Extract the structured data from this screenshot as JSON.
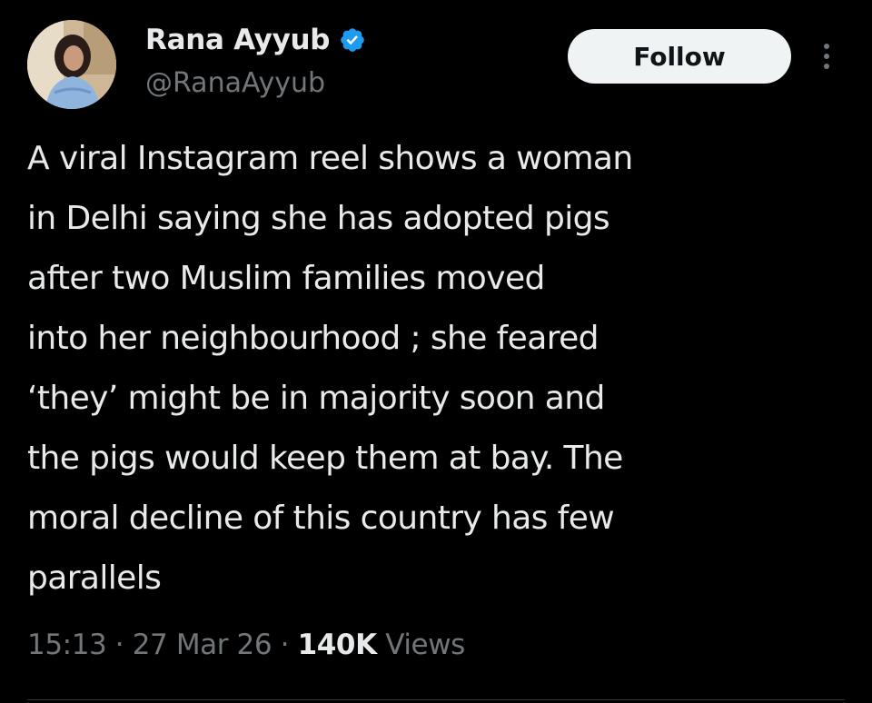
{
  "author": {
    "display_name": "Rana Ayyub",
    "handle": "@RanaAyyub",
    "verified": true,
    "verified_color": "#1d9bf0"
  },
  "actions": {
    "follow_label": "Follow",
    "more_icon": "more-vertical-icon"
  },
  "tweet": {
    "lines": [
      "A viral Instagram reel shows a woman",
      "in Delhi saying she has adopted pigs",
      "after two Muslim families moved",
      "into her neighbourhood ; she feared",
      "‘they’ might be in majority soon and",
      "the pigs would keep them at bay. The",
      "moral decline of this country has few",
      "parallels"
    ]
  },
  "meta": {
    "time": "15:13",
    "separator": " · ",
    "date": "27 Mar 26",
    "views_count": "140K",
    "views_label": "Views"
  },
  "colors": {
    "background": "#000000",
    "text_primary": "#e7e9ea",
    "text_secondary": "#71767b",
    "follow_bg": "#eff3f4",
    "follow_text": "#0f1419"
  }
}
